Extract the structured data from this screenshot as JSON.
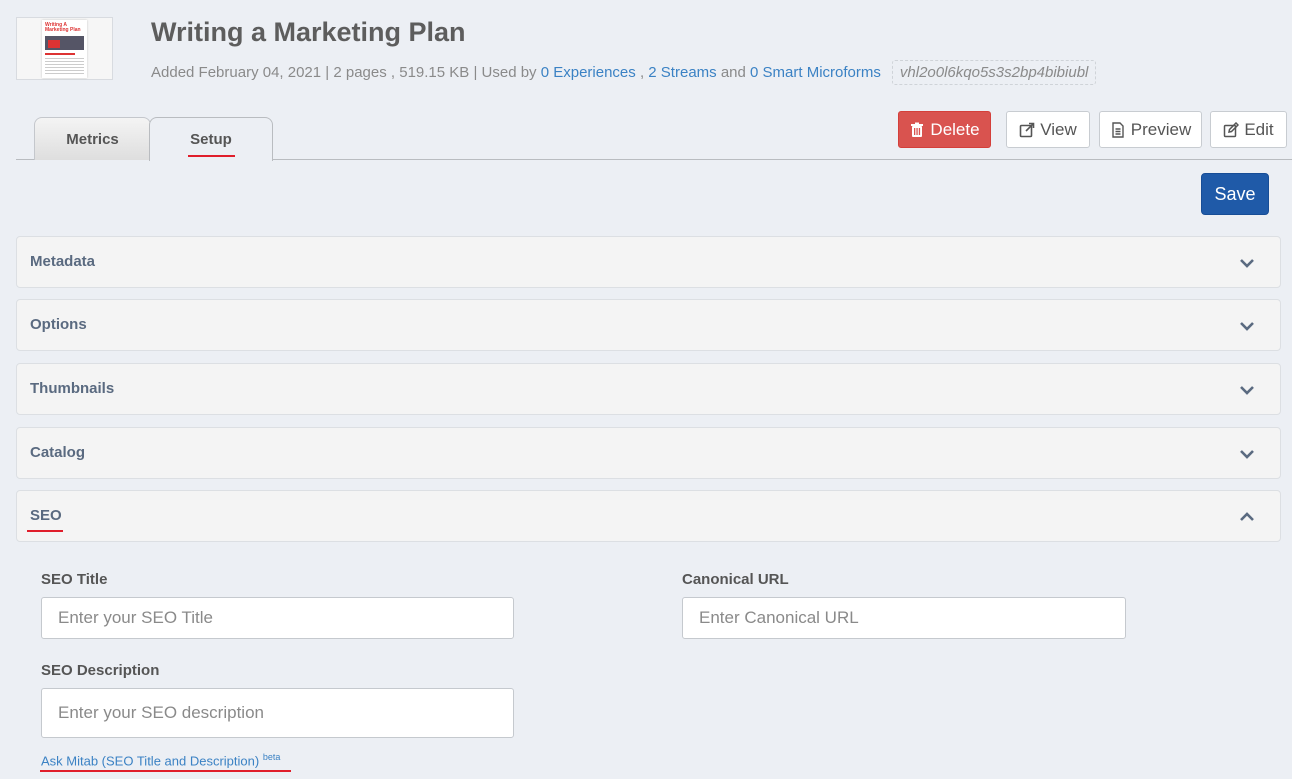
{
  "header": {
    "title": "Writing a Marketing Plan",
    "thumbnail_text": "Writing A Marketing Plan",
    "meta_prefix": "Added February 04, 2021 | 2 pages , 519.15 KB | Used by",
    "experiences_link": "0 Experiences",
    "comma": ",",
    "streams_link": "2 Streams",
    "and_text": "and",
    "microforms_link": "0 Smart Microforms",
    "hash_id": "vhl2o0l6kqo5s3s2bp4bibiubl"
  },
  "tabs": [
    {
      "label": "Metrics"
    },
    {
      "label": "Setup",
      "active": true
    }
  ],
  "toolbar": {
    "delete_label": "Delete",
    "view_label": "View",
    "preview_label": "Preview",
    "edit_label": "Edit",
    "save_label": "Save"
  },
  "panels": [
    {
      "label": "Metadata",
      "expanded": false
    },
    {
      "label": "Options",
      "expanded": false
    },
    {
      "label": "Thumbnails",
      "expanded": false
    },
    {
      "label": "Catalog",
      "expanded": false
    },
    {
      "label": "SEO",
      "expanded": true
    }
  ],
  "seo": {
    "title_label": "SEO Title",
    "title_placeholder": "Enter your SEO Title",
    "canonical_label": "Canonical URL",
    "canonical_placeholder": "Enter Canonical URL",
    "description_label": "SEO Description",
    "description_placeholder": "Enter your SEO description",
    "ask_link": "Ask Mitab (SEO Title and Description)",
    "ask_badge": "beta"
  },
  "colors": {
    "accent_blue": "#1f5aa8",
    "link_blue": "#3b82c4",
    "delete_red": "#d9534f",
    "highlight_red": "#e01e2b"
  },
  "icons": {
    "delete": "trash-icon",
    "view": "external-link-icon",
    "preview": "document-icon",
    "edit": "edit-icon",
    "collapsed": "chevron-down-icon",
    "expanded": "chevron-up-icon"
  }
}
